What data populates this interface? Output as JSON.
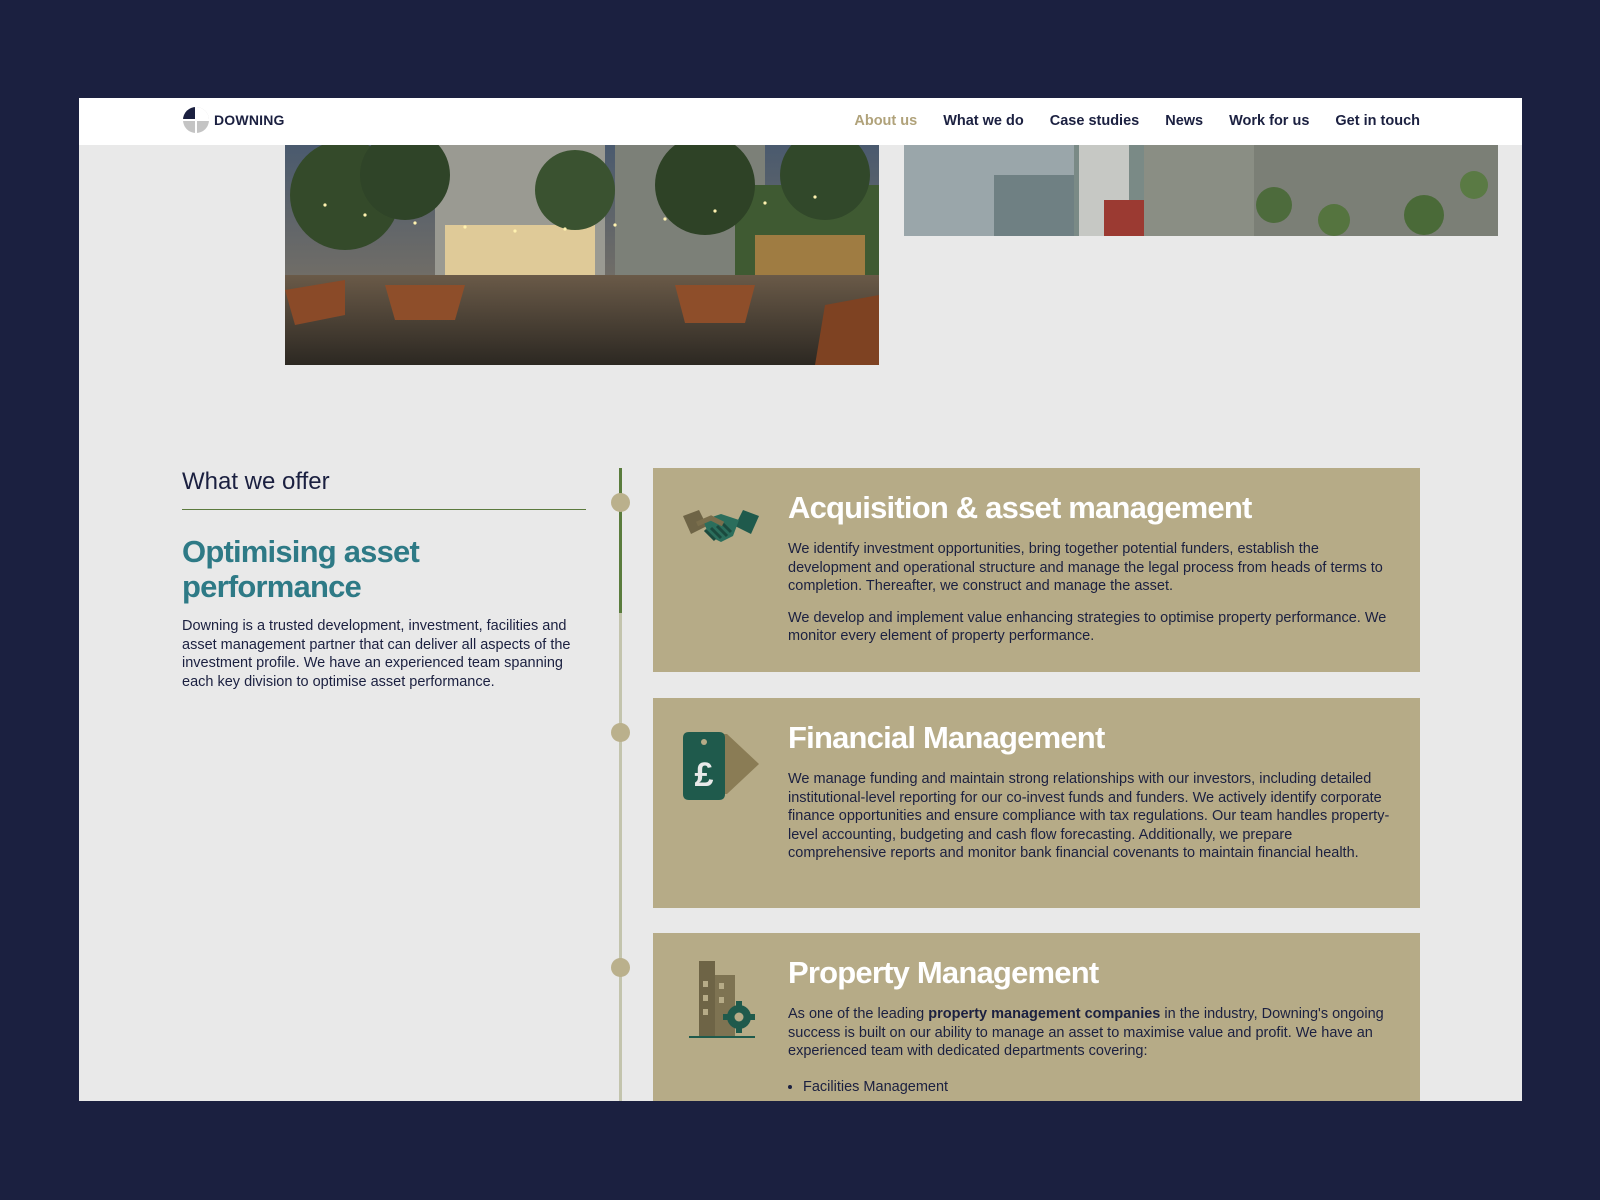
{
  "brand": {
    "name": "DOWNING"
  },
  "nav": {
    "items": [
      {
        "label": "About us",
        "active": true
      },
      {
        "label": "What we do",
        "active": false
      },
      {
        "label": "Case studies",
        "active": false
      },
      {
        "label": "News",
        "active": false
      },
      {
        "label": "Work for us",
        "active": false
      },
      {
        "label": "Get in touch",
        "active": false
      }
    ]
  },
  "offer": {
    "label": "What we offer",
    "headline": "Optimising asset performance",
    "intro": "Downing is a trusted development, investment, facilities and asset management partner that can deliver all aspects of the investment profile. We have an experienced team spanning each key division to optimise asset performance."
  },
  "cards": [
    {
      "icon": "handshake-icon",
      "title": "Acquisition & asset management",
      "p1": "We identify investment opportunities, bring together potential funders, establish the development and operational structure and manage the legal process from heads of terms to completion. Thereafter, we construct and manage the asset.",
      "p2": "We develop and implement value enhancing strategies to optimise property performance. We monitor every element of property performance."
    },
    {
      "icon": "pound-tag-icon",
      "title": "Financial Management",
      "p1": "We manage funding and maintain strong relationships with our investors, including detailed institutional-level reporting for our co-invest funds and funders. We actively identify corporate finance opportunities and ensure compliance with tax regulations. Our team handles property-level accounting, budgeting and cash flow forecasting. Additionally, we prepare comprehensive reports and monitor bank financial covenants to maintain financial health."
    },
    {
      "icon": "building-gear-icon",
      "title": "Property Management",
      "p1_before": "As one of the leading ",
      "p1_bold": "property management companies",
      "p1_after": " in the industry, Downing's ongoing success is built on our ability to manage an asset to maximise value and profit. We have an experienced team with dedicated departments covering:",
      "list": [
        "Facilities Management"
      ]
    }
  ],
  "colors": {
    "page_bg": "#1b2040",
    "content_bg": "#e9e9e9",
    "card_bg": "#b6ab87",
    "headline_teal": "#2e7a86",
    "nav_active": "#b0a27a",
    "timeline_green": "#5a7c3d"
  }
}
